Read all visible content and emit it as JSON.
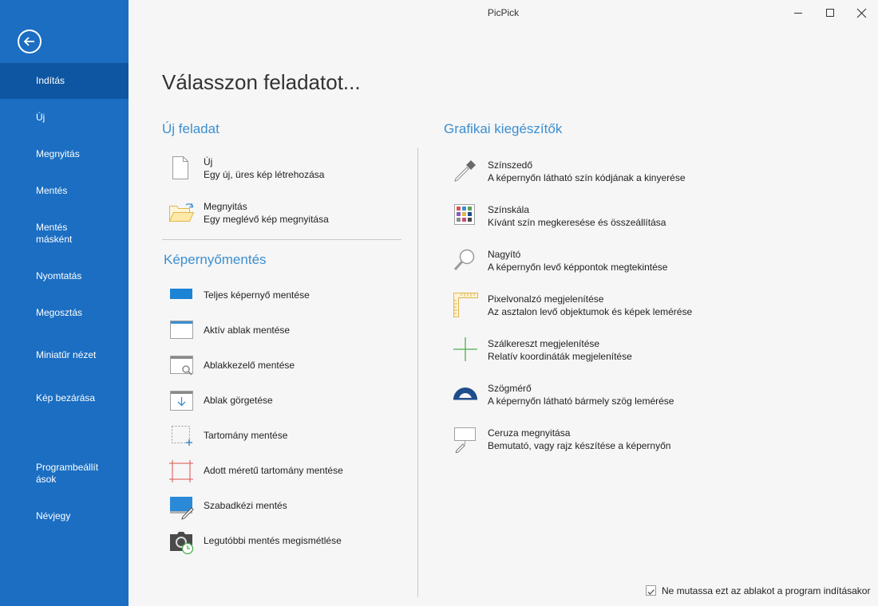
{
  "window": {
    "title": "PicPick"
  },
  "sidebar": {
    "items": [
      {
        "label": "Indítás"
      },
      {
        "label": "Új"
      },
      {
        "label": "Megnyitás"
      },
      {
        "label": "Mentés"
      },
      {
        "label": "Mentés másként"
      },
      {
        "label": "Nyomtatás"
      },
      {
        "label": "Megosztás"
      },
      {
        "label": "Miniatűr nézet"
      },
      {
        "label": "Kép bezárása"
      },
      {
        "label": "Programbeállítások"
      },
      {
        "label": "Névjegy"
      }
    ]
  },
  "main": {
    "title": "Válasszon feladatot...",
    "new_task": {
      "title": "Új feladat",
      "items": [
        {
          "label": "Új",
          "desc": "Egy új, üres kép létrehozása",
          "icon": "blank-page-icon"
        },
        {
          "label": "Megnyitás",
          "desc": "Egy meglévő kép megnyitása",
          "icon": "open-folder-icon"
        }
      ]
    },
    "capture": {
      "title": "Képernyőmentés",
      "items": [
        {
          "label": "Teljes képernyő mentése",
          "icon": "full-screen-icon"
        },
        {
          "label": "Aktív ablak mentése",
          "icon": "active-window-icon"
        },
        {
          "label": "Ablakkezelő mentése",
          "icon": "window-control-icon"
        },
        {
          "label": "Ablak görgetése",
          "icon": "scrolling-window-icon"
        },
        {
          "label": "Tartomány mentése",
          "icon": "region-icon"
        },
        {
          "label": "Adott méretű tartomány mentése",
          "icon": "fixed-region-icon"
        },
        {
          "label": "Szabadkézi mentés",
          "icon": "freehand-icon"
        },
        {
          "label": "Legutóbbi mentés megismétlése",
          "icon": "repeat-capture-icon"
        }
      ]
    },
    "graphic": {
      "title": "Grafikai kiegészítők",
      "items": [
        {
          "label": "Színszedő",
          "desc": "A képernyőn látható szín kódjának a kinyerése",
          "icon": "color-picker-icon"
        },
        {
          "label": "Színskála",
          "desc": "Kívánt szín megkeresése és összeállítása",
          "icon": "color-palette-icon"
        },
        {
          "label": "Nagyító",
          "desc": "A képernyőn levő képpontok megtekintése",
          "icon": "magnifier-icon"
        },
        {
          "label": "Pixelvonalzó megjelenítése",
          "desc": "Az asztalon levő objektumok és képek lemérése",
          "icon": "pixel-ruler-icon"
        },
        {
          "label": "Szálkereszt megjelenítése",
          "desc": "Relatív koordináták megjelenítése",
          "icon": "crosshair-icon"
        },
        {
          "label": "Szögmérő",
          "desc": "A képernyőn látható bármely szög lemérése",
          "icon": "protractor-icon"
        },
        {
          "label": "Ceruza megnyitása",
          "desc": "Bemutató, vagy rajz készítése a képernyőn",
          "icon": "whiteboard-icon"
        }
      ]
    }
  },
  "footer": {
    "checkbox_label": "Ne mutassa ezt az ablakot a program indításakor",
    "checked": true
  },
  "colors": {
    "sidebar": "#1b6ec2",
    "sidebar_active": "#0e56a1",
    "accent": "#3b8fd1"
  }
}
